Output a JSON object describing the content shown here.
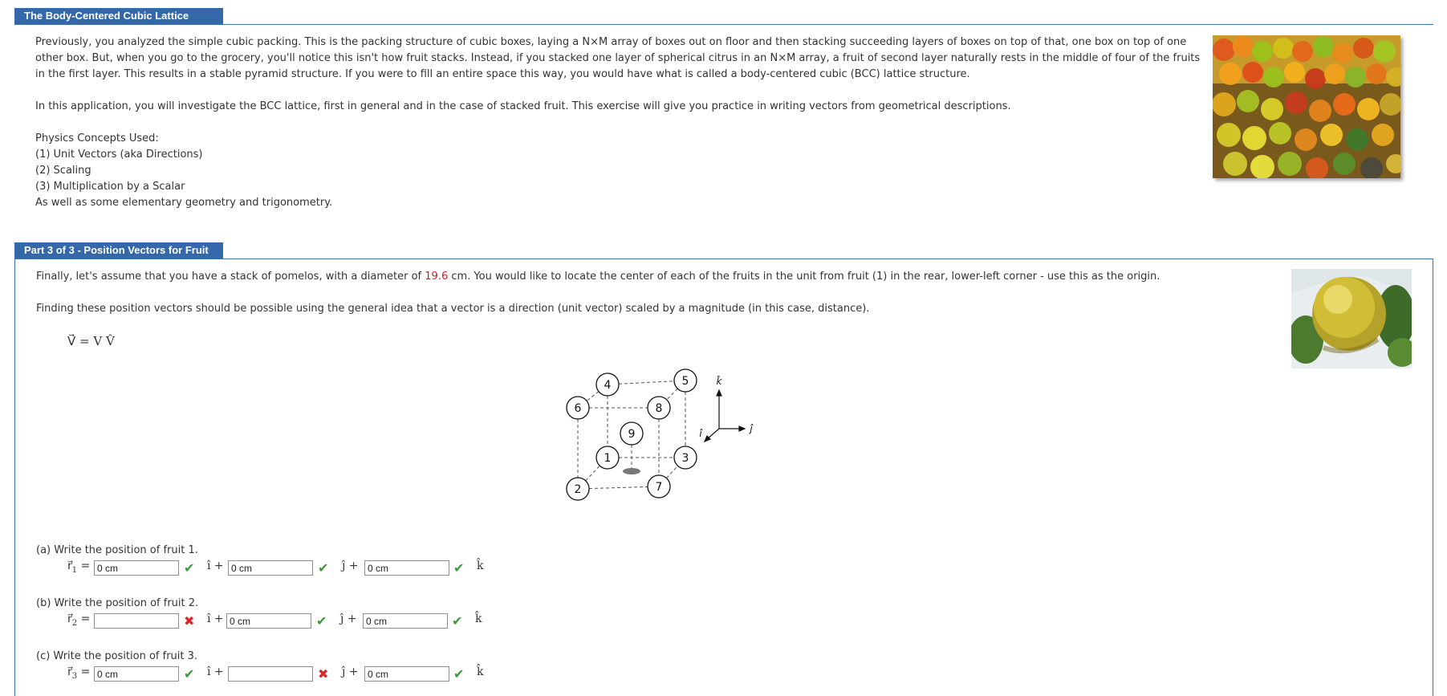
{
  "section1": {
    "title": "The Body-Centered Cubic Lattice",
    "para1": "Previously, you analyzed the simple cubic packing. This is the packing structure of cubic boxes, laying a N×M array of boxes out on floor and then stacking succeeding layers of boxes on top of that, one box on top of one other box. But, when you go to the grocery, you'll notice this isn't how fruit stacks. Instead, if you stacked one layer of spherical citrus in an N×M array, a fruit of second layer naturally rests in the middle of four of the fruits in the first layer. This results in a stable pyramid structure. If you were to fill an entire space this way, you would have what is called a body-centered cubic (BCC) lattice structure.",
    "para2": "In this application, you will investigate the BCC lattice, first in general and in the case of stacked fruit. This exercise will give you practice in writing vectors from geometrical descriptions.",
    "concepts_heading": "Physics Concepts Used:",
    "concepts": [
      "(1) Unit Vectors (aka Directions)",
      "(2) Scaling",
      "(3) Multiplication by a Scalar"
    ],
    "concepts_footer": "As well as some elementary geometry and trigonometry."
  },
  "section2": {
    "title": "Part 3 of 3 - Position Vectors for Fruit",
    "intro_before": "Finally, let's assume that you have a stack of pomelos, with a diameter of ",
    "diameter": "19.6",
    "intro_after": " cm. You would like to locate the center of each of the fruits in the unit from fruit (1) in the rear, lower-left corner - use this as the origin.",
    "finding": "Finding these position vectors should be possible using the general idea that a vector is a direction (unit vector) scaled by a magnitude (in this case, distance).",
    "formula": "V⃗ = V V̂"
  },
  "diagram": {
    "nodes": [
      "4",
      "5",
      "6",
      "8",
      "9",
      "1",
      "3",
      "2",
      "7"
    ],
    "axes": {
      "k": "k̂",
      "j": "ĵ",
      "i": "î"
    }
  },
  "questions": [
    {
      "label": "(a) Write the position of fruit 1.",
      "var": "r⃗",
      "sub": "1",
      "eq": "=",
      "fields": [
        {
          "value": "0 cm",
          "status": "correct"
        },
        {
          "value": "0 cm",
          "status": "correct"
        },
        {
          "value": "0 cm",
          "status": "correct"
        }
      ]
    },
    {
      "label": "(b) Write the position of fruit 2.",
      "var": "r⃗",
      "sub": "2",
      "eq": "=",
      "fields": [
        {
          "value": "",
          "status": "incorrect"
        },
        {
          "value": "0 cm",
          "status": "correct"
        },
        {
          "value": "0 cm",
          "status": "correct"
        }
      ]
    },
    {
      "label": "(c) Write the position of fruit 3.",
      "var": "r⃗",
      "sub": "3",
      "eq": "=",
      "fields": [
        {
          "value": "0 cm",
          "status": "correct"
        },
        {
          "value": "",
          "status": "incorrect"
        },
        {
          "value": "0 cm",
          "status": "correct"
        }
      ]
    }
  ],
  "units": {
    "i": "î +",
    "j": "ĵ +",
    "k": "k̂"
  },
  "icons": {
    "correct": "check-icon",
    "incorrect": "cross-icon"
  },
  "colors": {
    "header_bg": "#3568a8",
    "accent_red": "#cc1f1f",
    "check_green": "#3c9a3c",
    "cross_red": "#d42a2a"
  }
}
